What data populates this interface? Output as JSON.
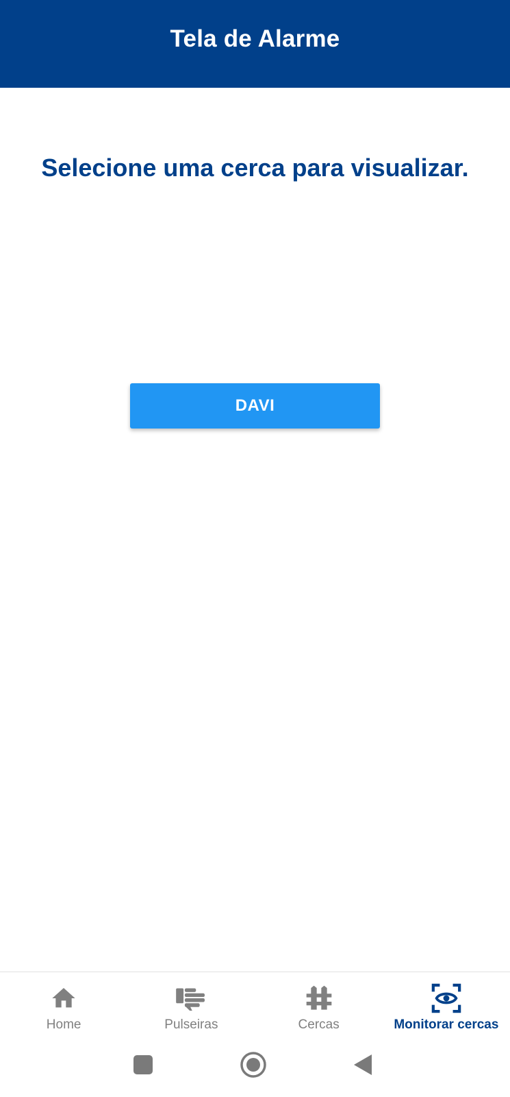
{
  "header": {
    "title": "Tela de Alarme"
  },
  "main": {
    "prompt": "Selecione uma cerca para visualizar.",
    "fences": [
      {
        "label": "DAVI"
      }
    ]
  },
  "bottom_nav": {
    "items": [
      {
        "label": "Home",
        "icon": "home-icon",
        "active": false
      },
      {
        "label": "Pulseiras",
        "icon": "hand-icon",
        "active": false
      },
      {
        "label": "Cercas",
        "icon": "fence-icon",
        "active": false
      },
      {
        "label": "Monitorar cercas",
        "icon": "eye-scan-icon",
        "active": true
      }
    ]
  },
  "system_nav": {
    "buttons": [
      "recents-icon",
      "home-circle-icon",
      "back-icon"
    ]
  },
  "colors": {
    "primary": "#01408a",
    "button": "#2196f3",
    "inactive": "#808080",
    "background": "#ffffff"
  }
}
